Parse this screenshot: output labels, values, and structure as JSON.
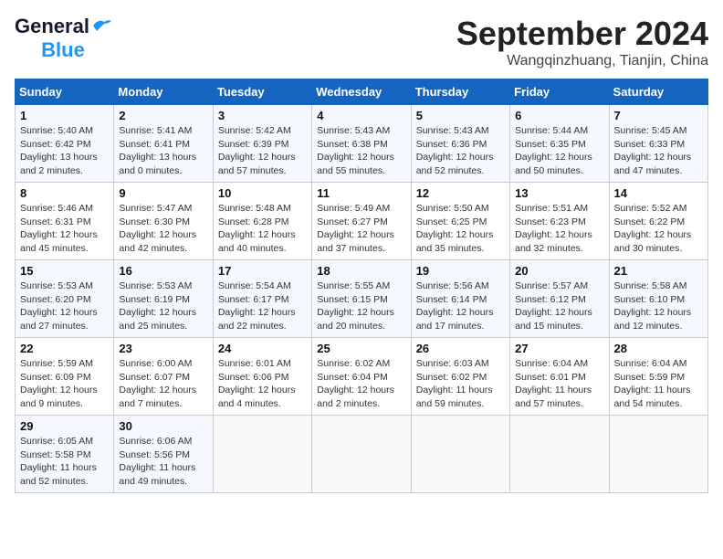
{
  "header": {
    "logo_general": "General",
    "logo_blue": "Blue",
    "month_title": "September 2024",
    "location": "Wangqinzhuang, Tianjin, China"
  },
  "calendar": {
    "days_of_week": [
      "Sunday",
      "Monday",
      "Tuesday",
      "Wednesday",
      "Thursday",
      "Friday",
      "Saturday"
    ],
    "weeks": [
      [
        {
          "day": "1",
          "sunrise": "Sunrise: 5:40 AM",
          "sunset": "Sunset: 6:42 PM",
          "daylight": "Daylight: 13 hours and 2 minutes."
        },
        {
          "day": "2",
          "sunrise": "Sunrise: 5:41 AM",
          "sunset": "Sunset: 6:41 PM",
          "daylight": "Daylight: 13 hours and 0 minutes."
        },
        {
          "day": "3",
          "sunrise": "Sunrise: 5:42 AM",
          "sunset": "Sunset: 6:39 PM",
          "daylight": "Daylight: 12 hours and 57 minutes."
        },
        {
          "day": "4",
          "sunrise": "Sunrise: 5:43 AM",
          "sunset": "Sunset: 6:38 PM",
          "daylight": "Daylight: 12 hours and 55 minutes."
        },
        {
          "day": "5",
          "sunrise": "Sunrise: 5:43 AM",
          "sunset": "Sunset: 6:36 PM",
          "daylight": "Daylight: 12 hours and 52 minutes."
        },
        {
          "day": "6",
          "sunrise": "Sunrise: 5:44 AM",
          "sunset": "Sunset: 6:35 PM",
          "daylight": "Daylight: 12 hours and 50 minutes."
        },
        {
          "day": "7",
          "sunrise": "Sunrise: 5:45 AM",
          "sunset": "Sunset: 6:33 PM",
          "daylight": "Daylight: 12 hours and 47 minutes."
        }
      ],
      [
        {
          "day": "8",
          "sunrise": "Sunrise: 5:46 AM",
          "sunset": "Sunset: 6:31 PM",
          "daylight": "Daylight: 12 hours and 45 minutes."
        },
        {
          "day": "9",
          "sunrise": "Sunrise: 5:47 AM",
          "sunset": "Sunset: 6:30 PM",
          "daylight": "Daylight: 12 hours and 42 minutes."
        },
        {
          "day": "10",
          "sunrise": "Sunrise: 5:48 AM",
          "sunset": "Sunset: 6:28 PM",
          "daylight": "Daylight: 12 hours and 40 minutes."
        },
        {
          "day": "11",
          "sunrise": "Sunrise: 5:49 AM",
          "sunset": "Sunset: 6:27 PM",
          "daylight": "Daylight: 12 hours and 37 minutes."
        },
        {
          "day": "12",
          "sunrise": "Sunrise: 5:50 AM",
          "sunset": "Sunset: 6:25 PM",
          "daylight": "Daylight: 12 hours and 35 minutes."
        },
        {
          "day": "13",
          "sunrise": "Sunrise: 5:51 AM",
          "sunset": "Sunset: 6:23 PM",
          "daylight": "Daylight: 12 hours and 32 minutes."
        },
        {
          "day": "14",
          "sunrise": "Sunrise: 5:52 AM",
          "sunset": "Sunset: 6:22 PM",
          "daylight": "Daylight: 12 hours and 30 minutes."
        }
      ],
      [
        {
          "day": "15",
          "sunrise": "Sunrise: 5:53 AM",
          "sunset": "Sunset: 6:20 PM",
          "daylight": "Daylight: 12 hours and 27 minutes."
        },
        {
          "day": "16",
          "sunrise": "Sunrise: 5:53 AM",
          "sunset": "Sunset: 6:19 PM",
          "daylight": "Daylight: 12 hours and 25 minutes."
        },
        {
          "day": "17",
          "sunrise": "Sunrise: 5:54 AM",
          "sunset": "Sunset: 6:17 PM",
          "daylight": "Daylight: 12 hours and 22 minutes."
        },
        {
          "day": "18",
          "sunrise": "Sunrise: 5:55 AM",
          "sunset": "Sunset: 6:15 PM",
          "daylight": "Daylight: 12 hours and 20 minutes."
        },
        {
          "day": "19",
          "sunrise": "Sunrise: 5:56 AM",
          "sunset": "Sunset: 6:14 PM",
          "daylight": "Daylight: 12 hours and 17 minutes."
        },
        {
          "day": "20",
          "sunrise": "Sunrise: 5:57 AM",
          "sunset": "Sunset: 6:12 PM",
          "daylight": "Daylight: 12 hours and 15 minutes."
        },
        {
          "day": "21",
          "sunrise": "Sunrise: 5:58 AM",
          "sunset": "Sunset: 6:10 PM",
          "daylight": "Daylight: 12 hours and 12 minutes."
        }
      ],
      [
        {
          "day": "22",
          "sunrise": "Sunrise: 5:59 AM",
          "sunset": "Sunset: 6:09 PM",
          "daylight": "Daylight: 12 hours and 9 minutes."
        },
        {
          "day": "23",
          "sunrise": "Sunrise: 6:00 AM",
          "sunset": "Sunset: 6:07 PM",
          "daylight": "Daylight: 12 hours and 7 minutes."
        },
        {
          "day": "24",
          "sunrise": "Sunrise: 6:01 AM",
          "sunset": "Sunset: 6:06 PM",
          "daylight": "Daylight: 12 hours and 4 minutes."
        },
        {
          "day": "25",
          "sunrise": "Sunrise: 6:02 AM",
          "sunset": "Sunset: 6:04 PM",
          "daylight": "Daylight: 12 hours and 2 minutes."
        },
        {
          "day": "26",
          "sunrise": "Sunrise: 6:03 AM",
          "sunset": "Sunset: 6:02 PM",
          "daylight": "Daylight: 11 hours and 59 minutes."
        },
        {
          "day": "27",
          "sunrise": "Sunrise: 6:04 AM",
          "sunset": "Sunset: 6:01 PM",
          "daylight": "Daylight: 11 hours and 57 minutes."
        },
        {
          "day": "28",
          "sunrise": "Sunrise: 6:04 AM",
          "sunset": "Sunset: 5:59 PM",
          "daylight": "Daylight: 11 hours and 54 minutes."
        }
      ],
      [
        {
          "day": "29",
          "sunrise": "Sunrise: 6:05 AM",
          "sunset": "Sunset: 5:58 PM",
          "daylight": "Daylight: 11 hours and 52 minutes."
        },
        {
          "day": "30",
          "sunrise": "Sunrise: 6:06 AM",
          "sunset": "Sunset: 5:56 PM",
          "daylight": "Daylight: 11 hours and 49 minutes."
        },
        {
          "day": "",
          "sunrise": "",
          "sunset": "",
          "daylight": ""
        },
        {
          "day": "",
          "sunrise": "",
          "sunset": "",
          "daylight": ""
        },
        {
          "day": "",
          "sunrise": "",
          "sunset": "",
          "daylight": ""
        },
        {
          "day": "",
          "sunrise": "",
          "sunset": "",
          "daylight": ""
        },
        {
          "day": "",
          "sunrise": "",
          "sunset": "",
          "daylight": ""
        }
      ]
    ]
  }
}
